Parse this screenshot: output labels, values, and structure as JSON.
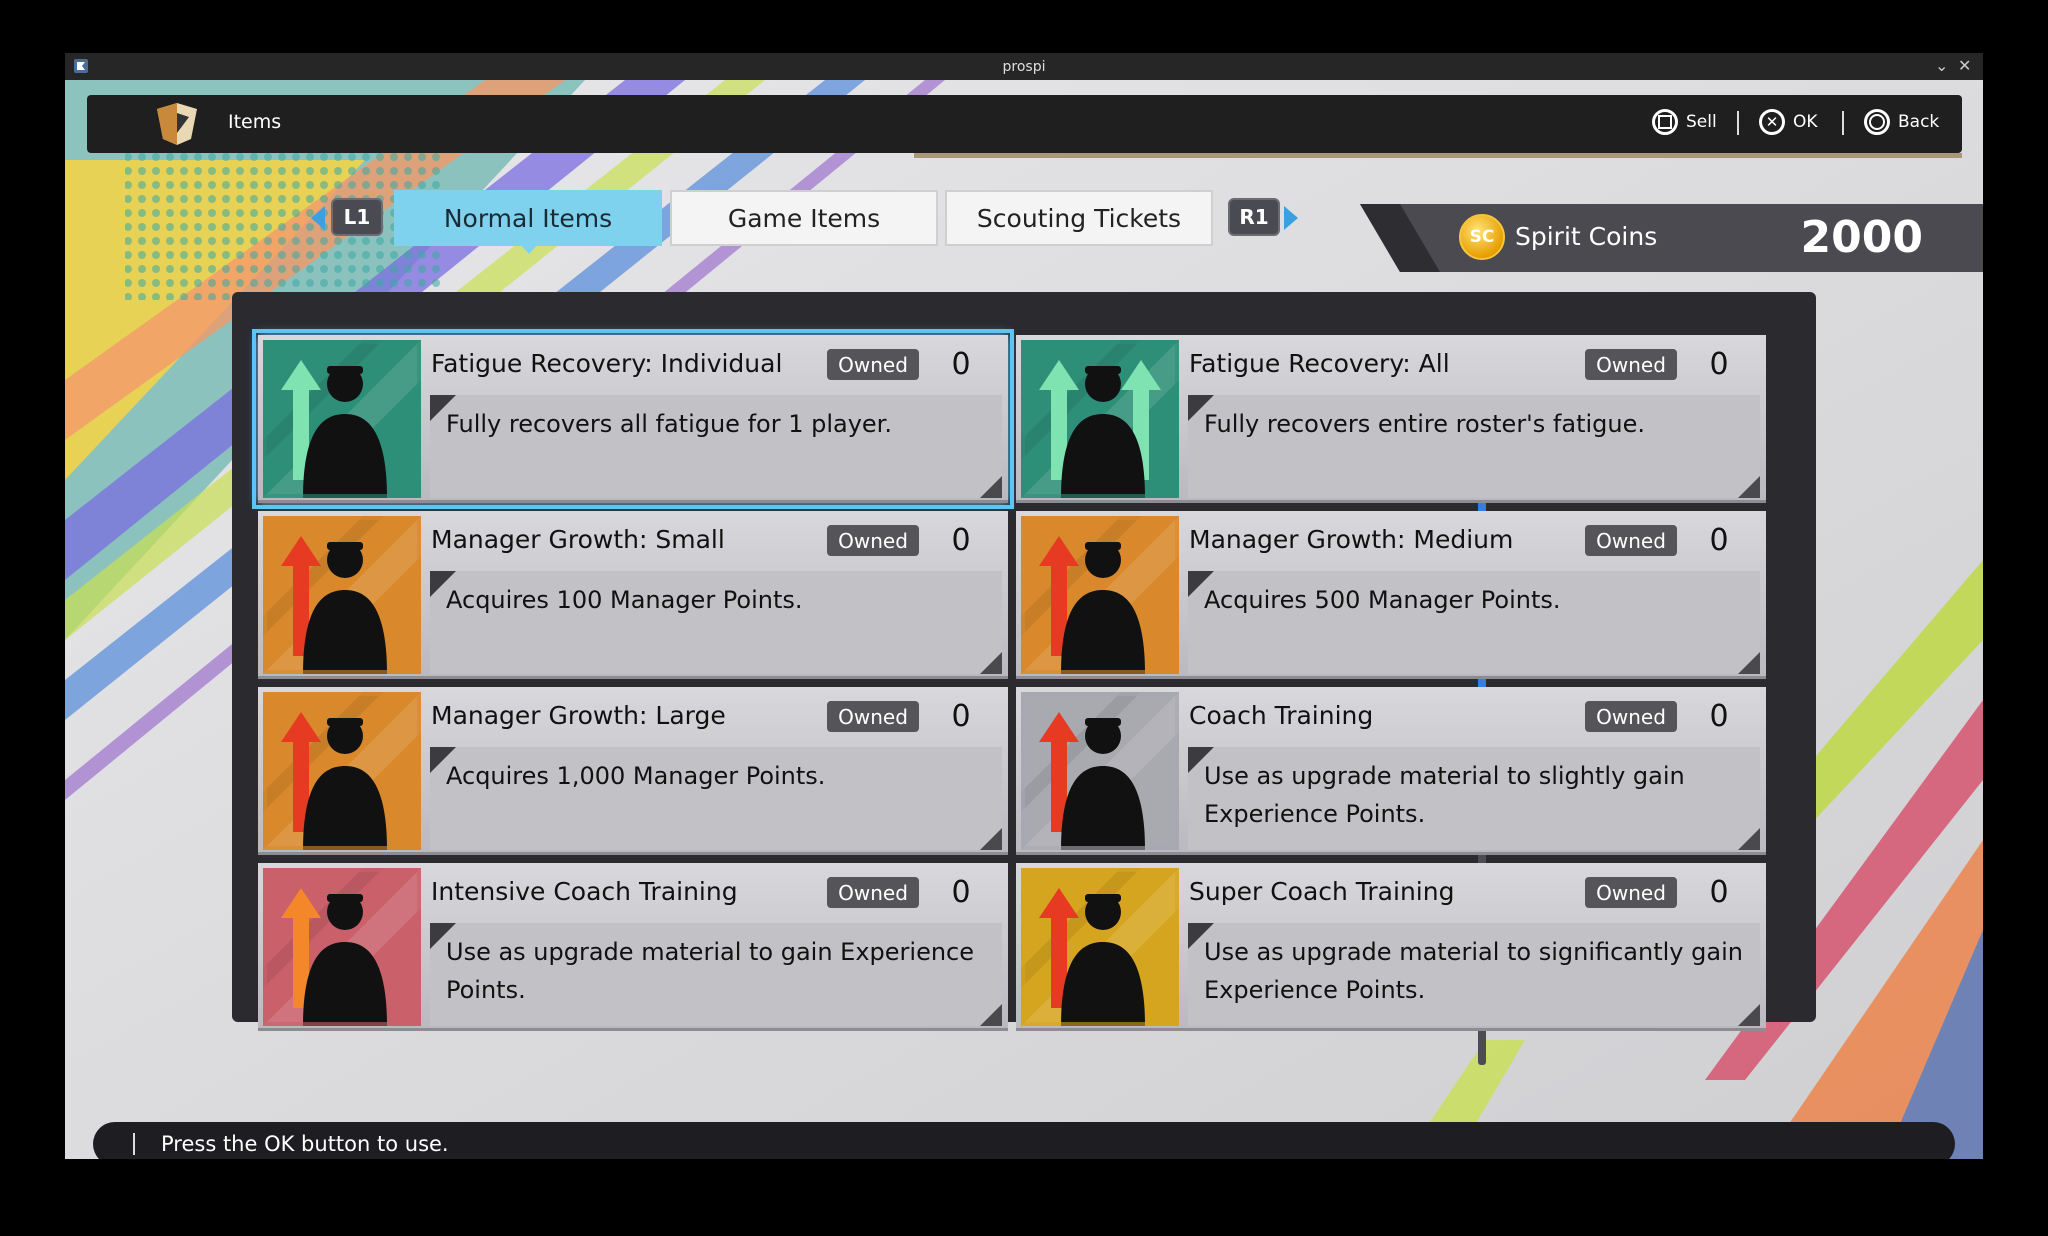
{
  "window": {
    "title": "prospi"
  },
  "header": {
    "title": "Items",
    "buttons": [
      {
        "label": "Sell",
        "icon": "square-button-icon"
      },
      {
        "label": "OK",
        "icon": "cross-button-icon"
      },
      {
        "label": "Back",
        "icon": "circle-button-icon"
      }
    ]
  },
  "tabs": {
    "left_shoulder": "L1",
    "right_shoulder": "R1",
    "items": [
      {
        "label": "Normal Items",
        "active": true
      },
      {
        "label": "Game Items",
        "active": false
      },
      {
        "label": "Scouting Tickets",
        "active": false
      }
    ]
  },
  "currency": {
    "coin_symbol": "SC",
    "label": "Spirit Coins",
    "value": "2000"
  },
  "owned_label": "Owned",
  "items": [
    {
      "name": "Fatigue Recovery: Individual",
      "count": "0",
      "description": "Fully recovers all fatigue for 1 player.",
      "icon": "fatigue-individual-icon",
      "theme": "#2e8f78"
    },
    {
      "name": "Fatigue Recovery: All",
      "count": "0",
      "description": "Fully recovers entire roster's fatigue.",
      "icon": "fatigue-all-icon",
      "theme": "#2e8f78"
    },
    {
      "name": "Manager Growth: Small",
      "count": "0",
      "description": "Acquires 100 Manager Points.",
      "icon": "manager-growth-small-icon",
      "theme": "#d9892b"
    },
    {
      "name": "Manager Growth: Medium",
      "count": "0",
      "description": "Acquires 500 Manager Points.",
      "icon": "manager-growth-medium-icon",
      "theme": "#d9892b"
    },
    {
      "name": "Manager Growth: Large",
      "count": "0",
      "description": "Acquires 1,000 Manager Points.",
      "icon": "manager-growth-large-icon",
      "theme": "#d9892b"
    },
    {
      "name": "Coach Training",
      "count": "0",
      "description": "Use as upgrade material to slightly gain Experience Points.",
      "icon": "coach-training-icon",
      "theme": "#a9a9b0"
    },
    {
      "name": "Intensive Coach Training",
      "count": "0",
      "description": "Use as upgrade material to gain Experience Points.",
      "icon": "intensive-coach-training-icon",
      "theme": "#c9606a"
    },
    {
      "name": "Super Coach Training",
      "count": "0",
      "description": "Use as upgrade material to significantly gain Experience Points.",
      "icon": "super-coach-training-icon",
      "theme": "#d6a51f"
    }
  ],
  "status": {
    "message": "Press the OK button to use."
  }
}
